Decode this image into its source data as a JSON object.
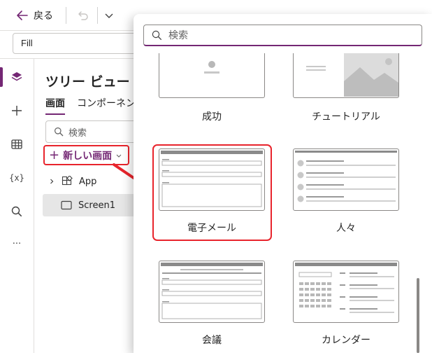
{
  "toolbar": {
    "back_label": "戻る",
    "property_value": "Fill"
  },
  "rail": {
    "items": [
      "tree-view",
      "insert",
      "data",
      "variables",
      "search",
      "more"
    ],
    "variables_label": "{x}",
    "more_label": "···"
  },
  "tree": {
    "title": "ツリー ビュー",
    "tabs": [
      "画面",
      "コンポーネン"
    ],
    "search_placeholder": "検索",
    "new_screen_label": "新しい画面",
    "nodes": [
      {
        "label": "App",
        "icon": "app-icon"
      },
      {
        "label": "Screen1",
        "icon": "screen-icon",
        "selected": true
      }
    ]
  },
  "flyout": {
    "search_placeholder": "検索",
    "templates": [
      {
        "label": "成功"
      },
      {
        "label": "チュートリアル"
      },
      {
        "label": "電子メール",
        "highlighted": true
      },
      {
        "label": "人々"
      },
      {
        "label": "会議"
      },
      {
        "label": "カレンダー"
      }
    ]
  },
  "colors": {
    "accent": "#742774",
    "highlight": "#e8242c"
  }
}
